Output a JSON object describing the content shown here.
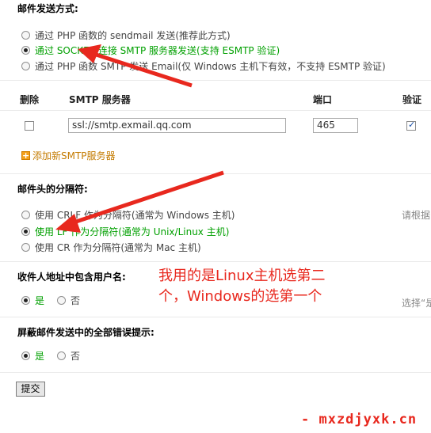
{
  "send_method": {
    "title": "邮件发送方式:",
    "options": [
      {
        "label": "通过 PHP 函数的 sendmail 发送(推荐此方式)",
        "selected": false
      },
      {
        "label": "通过 SOCKET 连接 SMTP 服务器发送(支持 ESMTP 验证)",
        "selected": true
      },
      {
        "label": "通过 PHP 函数 SMTP 发送 Email(仅 Windows 主机下有效，不支持 ESMTP 验证)",
        "selected": false
      }
    ]
  },
  "smtp_table": {
    "headers": {
      "delete": "删除",
      "server": "SMTP 服务器",
      "port": "端口",
      "auth": "验证"
    },
    "row": {
      "delete_checked": false,
      "server": "ssl://smtp.exmail.qq.com",
      "port": "465",
      "auth_checked": true
    },
    "add_label": "添加新SMTP服务器"
  },
  "separator": {
    "title": "邮件头的分隔符:",
    "hint": "请根据",
    "options": [
      {
        "label": "使用 CRLF 作为分隔符(通常为 Windows 主机)",
        "selected": false
      },
      {
        "label": "使用 LF 作为分隔符(通常为 Unix/Linux 主机)",
        "selected": true
      },
      {
        "label": "使用 CR 作为分隔符(通常为 Mac 主机)",
        "selected": false
      }
    ]
  },
  "include_username": {
    "title": "收件人地址中包含用户名:",
    "yes": "是",
    "no": "否",
    "value": "yes",
    "hint": "选择“是"
  },
  "suppress_errors": {
    "title": "屏蔽邮件发送中的全部错误提示:",
    "yes": "是",
    "no": "否",
    "value": "yes"
  },
  "annotation": {
    "line1": "我用的是Linux主机选第二",
    "line2": "个，Windows的选第一个"
  },
  "submit_label": "提交",
  "watermark": "-  mxzdjyxk.cn",
  "colors": {
    "selected_text": "#00a000",
    "annotation": "#e8281e",
    "link": "#c47b00"
  }
}
